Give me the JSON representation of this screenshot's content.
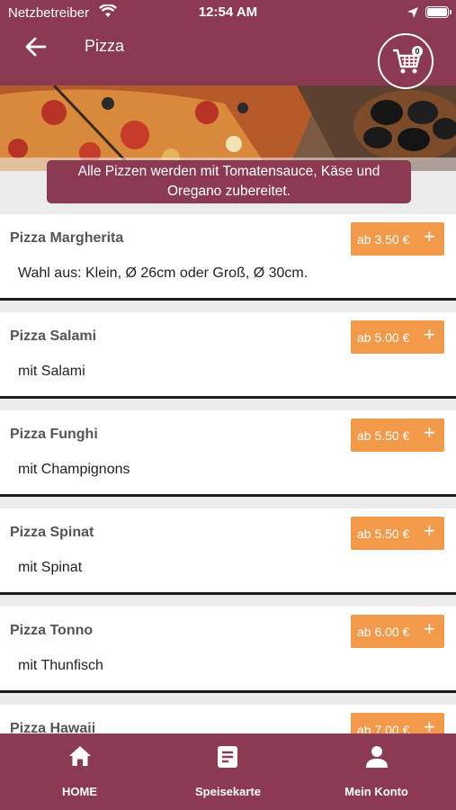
{
  "status": {
    "carrier": "Netzbetreiber",
    "time": "12:54 AM"
  },
  "header": {
    "title": "Pizza",
    "cart_count": "0"
  },
  "notice": {
    "line1": "Alle Pizzen werden mit Tomatensauce, Käse und",
    "line2": "Oregano zubereitet."
  },
  "items": [
    {
      "name": "Pizza Margherita",
      "price": "ab 3.50 €",
      "desc": "Wahl aus: Klein, Ø 26cm oder Groß, Ø 30cm."
    },
    {
      "name": "Pizza Salami",
      "price": "ab 5.00 €",
      "desc": "mit Salami"
    },
    {
      "name": "Pizza Funghi",
      "price": "ab 5.50 €",
      "desc": "mit Champignons"
    },
    {
      "name": "Pizza Spinat",
      "price": "ab 5.50 €",
      "desc": "mit Spinat"
    },
    {
      "name": "Pizza Tonno",
      "price": "ab 6.00 €",
      "desc": "mit Thunfisch"
    },
    {
      "name": "Pizza Hawaii",
      "price": "ab 7.00 €",
      "desc": ""
    }
  ],
  "plus_label": "+",
  "nav": [
    {
      "label": "HOME",
      "icon": "home-icon"
    },
    {
      "label": "Speisekarte",
      "icon": "menu-icon"
    },
    {
      "label": "Mein Konto",
      "icon": "person-icon"
    }
  ],
  "colors": {
    "brand": "#8c3a51",
    "accent": "#f2994a"
  }
}
